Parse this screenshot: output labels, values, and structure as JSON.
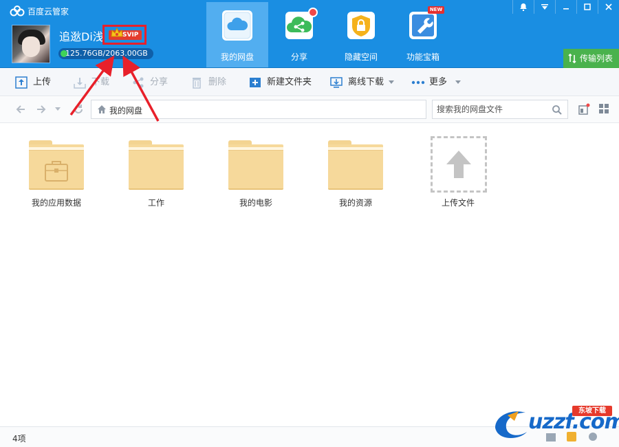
{
  "app": {
    "title": "百度云管家"
  },
  "user": {
    "name": "追逖Di浅",
    "badge": "SVIP",
    "quota": "125.76GB/2063.00GB",
    "quota_used_fraction": 0.061
  },
  "nav_tabs": [
    {
      "label": "我的网盘",
      "icon": "cloud-icon",
      "active": true
    },
    {
      "label": "分享",
      "icon": "share-icon",
      "active": false
    },
    {
      "label": "隐藏空间",
      "icon": "lock-icon",
      "active": false
    },
    {
      "label": "功能宝箱",
      "icon": "wrench-icon",
      "active": false,
      "badge": "NEW"
    }
  ],
  "transfer": {
    "label": "传输列表"
  },
  "toolbar": {
    "upload": "上传",
    "download": "下载",
    "share": "分享",
    "delete": "删除",
    "new_folder": "新建文件夹",
    "offline_download": "离线下载",
    "more": "更多"
  },
  "address": {
    "path": "我的网盘"
  },
  "search": {
    "placeholder": "搜索我的网盘文件"
  },
  "files": [
    {
      "name": "我的应用数据",
      "type": "app-folder"
    },
    {
      "name": "工作",
      "type": "folder"
    },
    {
      "name": "我的电影",
      "type": "folder"
    },
    {
      "name": "我的资源",
      "type": "folder"
    },
    {
      "name": "上传文件",
      "type": "upload"
    }
  ],
  "status": {
    "count": "4项"
  },
  "watermark": {
    "text": "uzzf.com",
    "ribbon": "东坡下载"
  },
  "colors": {
    "header_bg": "#1a8ee2",
    "active_tab": "#52aef0",
    "transfer_green": "#4ab24d",
    "folder": "#f6d99b",
    "annotation_red": "#e8202a"
  }
}
